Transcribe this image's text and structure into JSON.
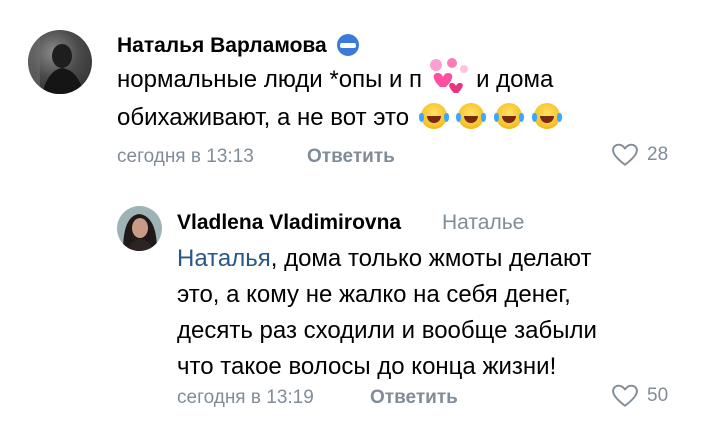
{
  "comments": [
    {
      "author": "Наталья Варламова",
      "text_line1": "нормальные люди *опы и п",
      "text_line1_end": "и дома",
      "text_line2": "обихаживают, а не вот это",
      "emoji_name": "laughing-tears-icon",
      "time": "сегодня в 13:13",
      "reply_label": "Ответить",
      "likes": "28"
    },
    {
      "author": "Vladlena Vladimirovna",
      "reply_to": "Наталье",
      "mention": "Наталья",
      "text_line1": ", дома только жмоты делают",
      "text_line2": "это, а кому не жалко на себя денег,",
      "text_line3": "десять раз сходили и вообще забыли",
      "text_line4": "что такое волосы до конца жизни!",
      "time": "сегодня в 13:19",
      "reply_label": "Ответить",
      "likes": "50"
    }
  ],
  "colors": {
    "meta": "#818c99",
    "link": "#2a5885",
    "sticker": "#ff5fa8"
  }
}
